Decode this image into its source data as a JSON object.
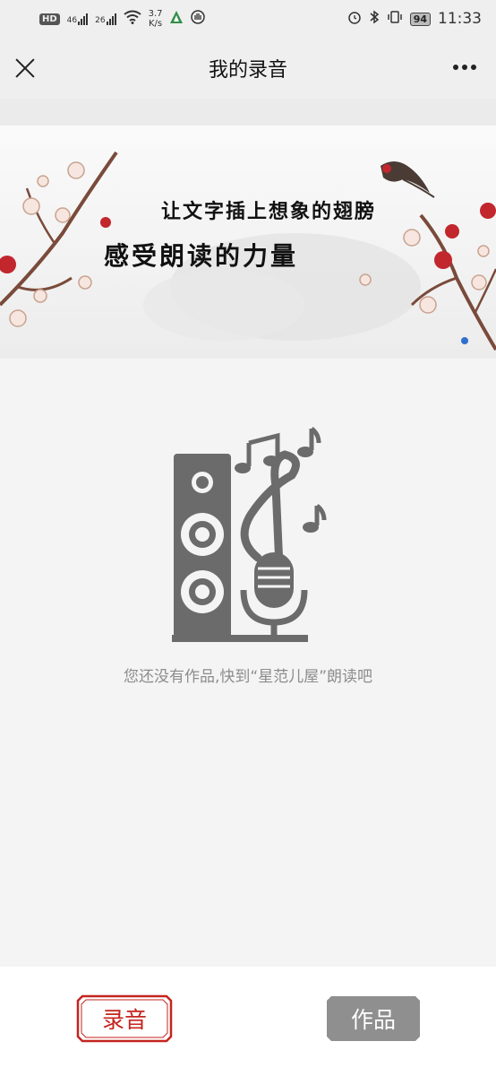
{
  "status_bar": {
    "hd": "HD",
    "net1": "46",
    "net2": "26",
    "speed_value": "3.7",
    "speed_unit": "K/s",
    "battery": "94",
    "time": "11:33"
  },
  "nav": {
    "title": "我的录音"
  },
  "banner": {
    "line1": "让文字插上想象的翅膀",
    "line2": "感受朗读的力量"
  },
  "empty": {
    "message": "您还没有作品,快到“星范儿屋”朗读吧"
  },
  "tabs": {
    "record": "录音",
    "works": "作品"
  },
  "colors": {
    "accent_red": "#c4241f",
    "inactive_gray": "#8f8f8f",
    "icon_gray": "#6b6b6b"
  }
}
